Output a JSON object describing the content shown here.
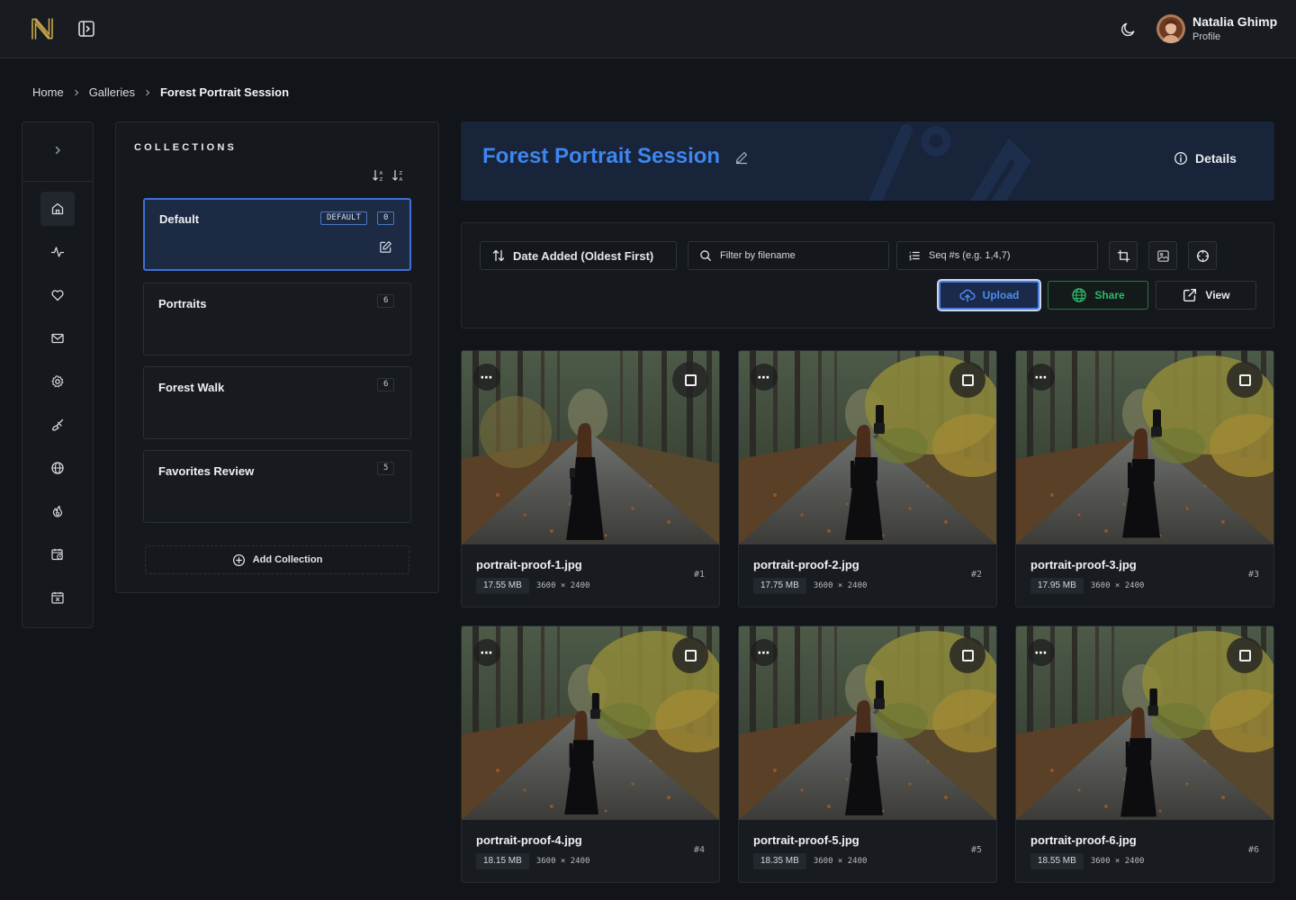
{
  "header": {
    "user_name": "Natalia Ghimp",
    "user_role": "Profile",
    "icons": [
      "logo-n",
      "sidebar-toggle-icon",
      "moon-icon",
      "avatar"
    ]
  },
  "breadcrumb": {
    "items": [
      "Home",
      "Galleries"
    ],
    "current": "Forest Portrait Session"
  },
  "rail": {
    "icons": [
      "chevron-right-icon",
      "home-icon",
      "activity-icon",
      "heart-icon",
      "mail-icon",
      "gear-icon",
      "brush-icon",
      "globe-icon",
      "flame-icon",
      "calendar-clock-icon",
      "calendar-x-icon"
    ]
  },
  "collections": {
    "title": "COLLECTIONS",
    "items": [
      {
        "name": "Default",
        "tag": "DEFAULT",
        "count": "0"
      },
      {
        "name": "Portraits",
        "count": "6"
      },
      {
        "name": "Forest Walk",
        "count": "6"
      },
      {
        "name": "Favorites Review",
        "count": "5"
      }
    ],
    "add_label": "Add Collection"
  },
  "gallery": {
    "title": "Forest Portrait Session",
    "details_label": "Details"
  },
  "toolbar": {
    "sort_label": "Date Added (Oldest First)",
    "filter_placeholder": "Filter by filename",
    "seq_placeholder": "Seq #s (e.g. 1,4,7)",
    "upload_label": "Upload",
    "share_label": "Share",
    "view_label": "View"
  },
  "photos": [
    {
      "name": "portrait-proof-1.jpg",
      "size": "17.55 MB",
      "dims": "3600 × 2400",
      "seq": "#1"
    },
    {
      "name": "portrait-proof-2.jpg",
      "size": "17.75 MB",
      "dims": "3600 × 2400",
      "seq": "#2"
    },
    {
      "name": "portrait-proof-3.jpg",
      "size": "17.95 MB",
      "dims": "3600 × 2400",
      "seq": "#3"
    },
    {
      "name": "portrait-proof-4.jpg",
      "size": "18.15 MB",
      "dims": "3600 × 2400",
      "seq": "#4"
    },
    {
      "name": "portrait-proof-5.jpg",
      "size": "18.35 MB",
      "dims": "3600 × 2400",
      "seq": "#5"
    },
    {
      "name": "portrait-proof-6.jpg",
      "size": "18.55 MB",
      "dims": "3600 × 2400",
      "seq": "#6"
    }
  ],
  "colors": {
    "accent": "#3e86ef",
    "share": "#2fb86a",
    "background": "#111418",
    "logo": "#c9a84c"
  }
}
